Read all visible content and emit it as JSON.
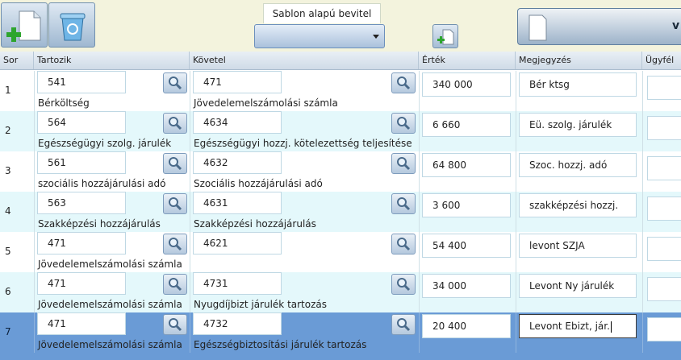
{
  "toolbar": {
    "new_icon": "new-document-add-icon",
    "delete_icon": "recycle-bin-icon",
    "template_label": "Sablon alapú bevitel",
    "template_selected": "",
    "add_small_icon": "small-add-document-icon",
    "right_panel_text": "v"
  },
  "columns": {
    "sor": "Sor",
    "tartozik": "Tartozik",
    "kovetel": "Követel",
    "ertek": "Érték",
    "megjegyzes": "Megjegyzés",
    "ugyfel": "Ügyfél"
  },
  "rows": [
    {
      "sor": "1",
      "tartozik": "541",
      "tartozik_desc": "Bérköltség",
      "kovetel": "471",
      "kovetel_desc": "Jövedelemelszámolási számla",
      "ertek": "340 000",
      "megjegyzes": "Bér ktsg"
    },
    {
      "sor": "2",
      "tartozik": "564",
      "tartozik_desc": "Egészségügyi szolg. járulék",
      "kovetel": "4634",
      "kovetel_desc": "Egészségügyi hozzj. kötelezettség teljesítése",
      "ertek": "6 660",
      "megjegyzes": "Eü. szolg. járulék"
    },
    {
      "sor": "3",
      "tartozik": "561",
      "tartozik_desc": "szociális hozzájárulási adó",
      "kovetel": "4632",
      "kovetel_desc": "Szociális hozzájárulási adó",
      "ertek": "64 800",
      "megjegyzes": "Szoc. hozzj. adó"
    },
    {
      "sor": "4",
      "tartozik": "563",
      "tartozik_desc": "Szakképzési hozzájárulás",
      "kovetel": "4631",
      "kovetel_desc": "Szakképzési hozzájárulás",
      "ertek": "3 600",
      "megjegyzes": "szakképzési hozzj."
    },
    {
      "sor": "5",
      "tartozik": "471",
      "tartozik_desc": "Jövedelemelszámolási számla",
      "kovetel": "4621",
      "kovetel_desc": "",
      "ertek": "54 400",
      "megjegyzes": "levont SZJA"
    },
    {
      "sor": "6",
      "tartozik": "471",
      "tartozik_desc": "Jövedelemelszámolási számla",
      "kovetel": "4731",
      "kovetel_desc": "Nyugdíjbizt járulék tartozás",
      "ertek": "34 000",
      "megjegyzes": "Levont Ny járulék"
    },
    {
      "sor": "7",
      "tartozik": "471",
      "tartozik_desc": "Jövedelemelszámolási számla",
      "kovetel": "4732",
      "kovetel_desc": "Egészségbiztosítási járulék tartozás",
      "ertek": "20 400",
      "megjegyzes": "Levont Ebizt, jár."
    }
  ],
  "search_icon": "magnifier-icon",
  "selected_row": "7",
  "colors": {
    "selected_row": "#6a9bd6",
    "alt_row": "#e4f8fb",
    "toolbar_bg": "#f3f3dd"
  }
}
